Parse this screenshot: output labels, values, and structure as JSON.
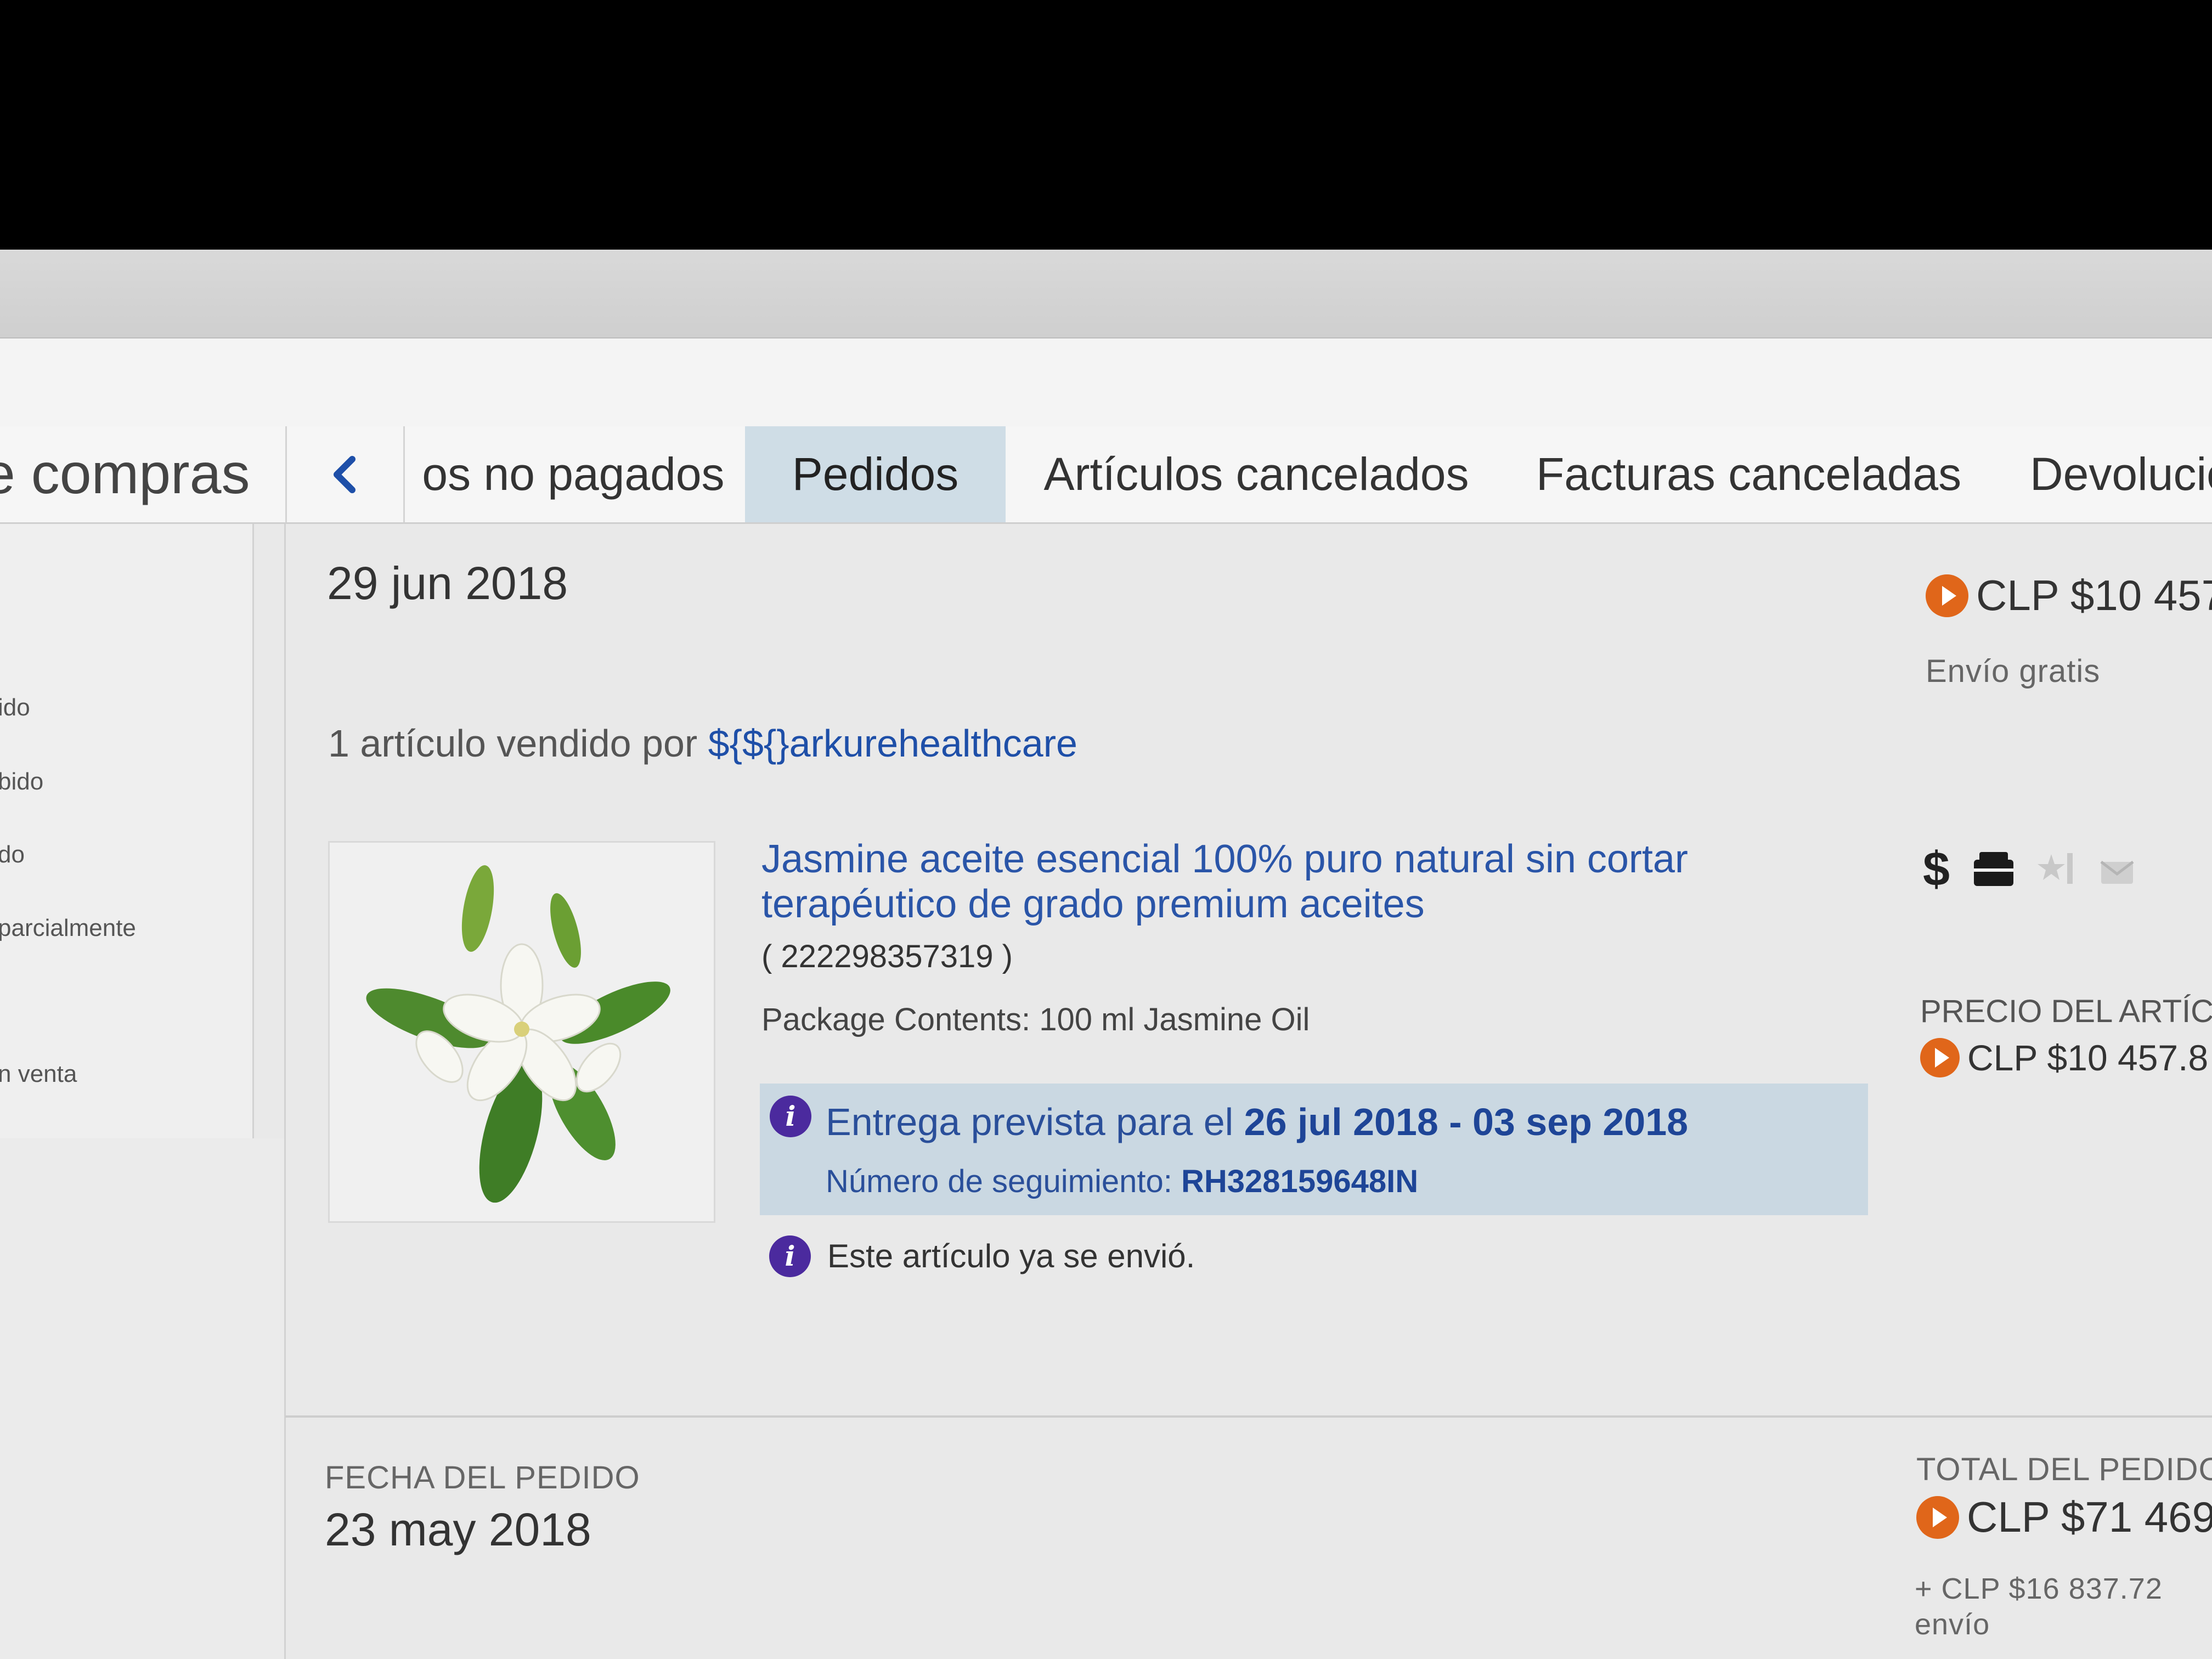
{
  "header": {
    "page_title": "e compras"
  },
  "tabs": [
    {
      "label": "os no pagados"
    },
    {
      "label": "Pedidos"
    },
    {
      "label": "Artículos cancelados"
    },
    {
      "label": "Facturas canceladas"
    },
    {
      "label": "Devolucio"
    }
  ],
  "sidebar": {
    "items": [
      {
        "label": "ido"
      },
      {
        "label": "bido"
      },
      {
        "label": "do"
      },
      {
        "label": "parcialmente"
      },
      {
        "label": "n venta"
      }
    ]
  },
  "orders": [
    {
      "date": "29 jun 2018",
      "total": "CLP $10 457",
      "shipping": "Envío gratis",
      "seller_prefix": "1 artículo vendido por",
      "seller": "${${}arkurehealthcare",
      "item": {
        "title": "Jasmine aceite esencial 100% puro natural sin cortar terapéutico de grado premium aceites",
        "number": "( 222298357319 )",
        "package": "Package Contents: 100 ml Jasmine Oil",
        "delivery_prefix": "Entrega prevista para el",
        "delivery_dates": "26 jul 2018 - 03 sep 2018",
        "tracking_prefix": "Número de seguimiento:",
        "tracking_number": "RH328159648IN",
        "shipped_note": "Este artículo ya se envió.",
        "price_label": "PRECIO DEL ARTÍCU",
        "price": "CLP $10 457.8"
      }
    },
    {
      "date_label": "FECHA DEL PEDIDO",
      "date": "23 may 2018",
      "total_label": "TOTAL DEL PEDIDO",
      "total": "CLP $71 469.",
      "shipping": "+ CLP $16 837.72",
      "shipping_suffix": "envío"
    }
  ],
  "icons": {
    "prev_tab": "chevron-left-icon",
    "info": "info-icon",
    "coin": "ebay-bucks-icon",
    "status": [
      "dollar-icon",
      "package-icon",
      "feedback-star-icon",
      "shipping-icon"
    ]
  },
  "colors": {
    "link": "#1e4fa8",
    "active_tab": "#cfdde6",
    "delivery_box": "#cad8e2",
    "info_icon": "#4b2a9e",
    "coin": "#e0661a"
  }
}
